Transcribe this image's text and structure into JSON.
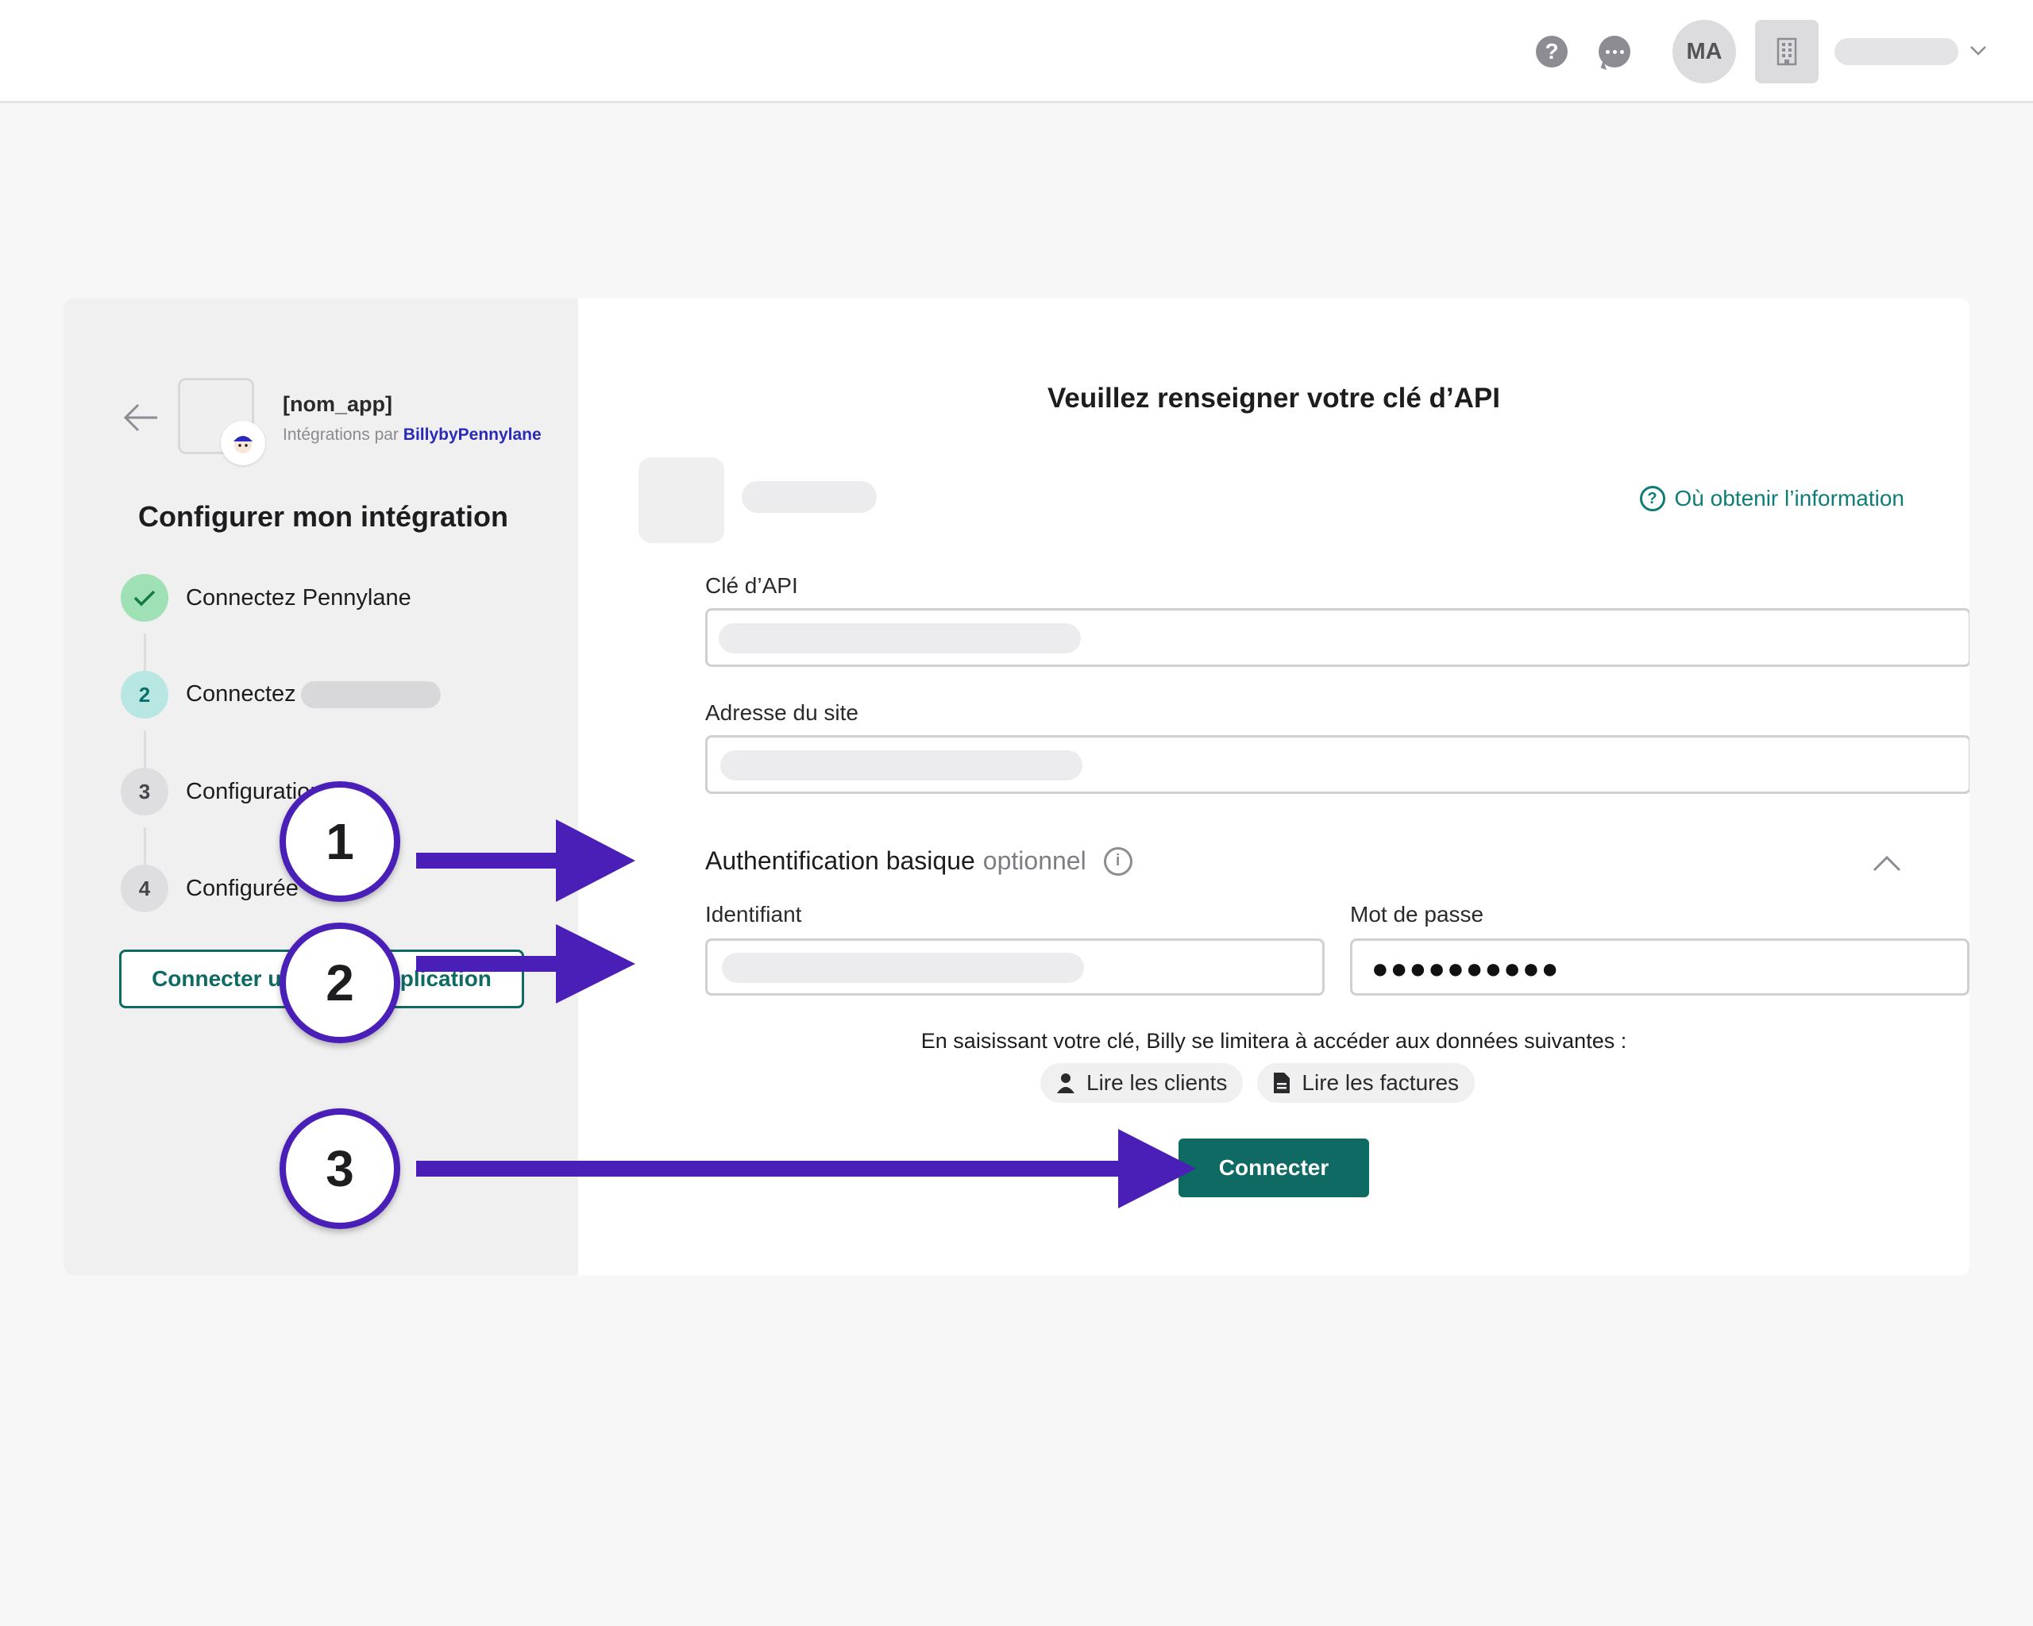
{
  "topbar": {
    "help_icon": "?",
    "chat_icon": "chat-bubble",
    "avatar_initials": "MA",
    "company_icon": "building-icon"
  },
  "sidebar": {
    "app_name": "[nom_app]",
    "integrations_by": "Intégrations par",
    "brand": "BillybyPennylane",
    "title": "Configurer mon intégration",
    "steps": [
      {
        "number": "",
        "label": "Connectez Pennylane",
        "status": "done"
      },
      {
        "number": "2",
        "label": "Connectez",
        "status": "active"
      },
      {
        "number": "3",
        "label": "Configuration",
        "status": "pending"
      },
      {
        "number": "4",
        "label": "Configurée",
        "status": "pending"
      }
    ],
    "connect_other_label": "Connecter une autre application"
  },
  "form": {
    "title": "Veuillez renseigner votre clé d’API",
    "help_link": "Où obtenir l’information",
    "api_key_label": "Clé d’API",
    "site_address_label": "Adresse du site",
    "auth_title": "Authentification basique",
    "auth_optional": "optionnel",
    "username_label": "Identifiant",
    "password_label": "Mot de passe",
    "password_value": "●●●●●●●●●●",
    "notice": "En saisissant votre clé, Billy se limitera à accéder aux données suivantes :",
    "scopes": [
      "Lire les clients",
      "Lire les factures"
    ],
    "connect_label": "Connecter"
  },
  "annotations": [
    "1",
    "2",
    "3"
  ],
  "colors": {
    "accent": "#0f6a64",
    "annotation": "#4a1fb8",
    "brand": "#2b2ab8"
  }
}
